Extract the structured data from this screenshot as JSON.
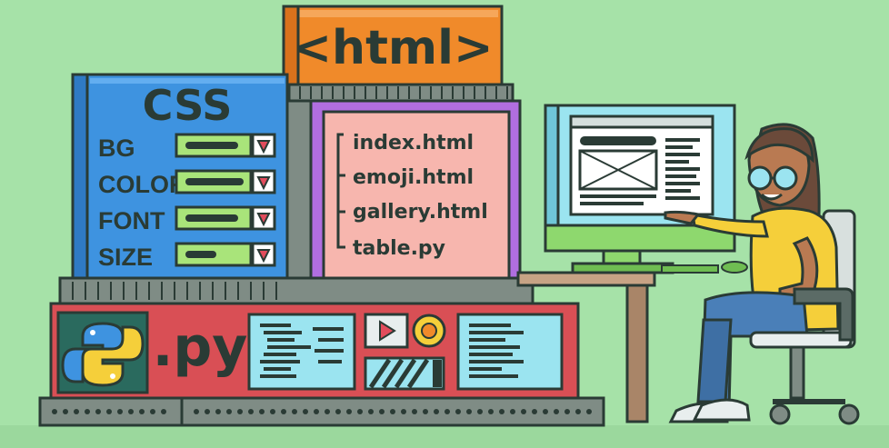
{
  "html_panel": {
    "title": "<html>"
  },
  "css_panel": {
    "title": "CSS",
    "rows": [
      {
        "label": "BG"
      },
      {
        "label": "COLOR"
      },
      {
        "label": "FONT"
      },
      {
        "label": "SIZE"
      }
    ]
  },
  "file_panel": {
    "files": [
      "index.html",
      "emoji.html",
      "gallery.html",
      "table.py"
    ]
  },
  "py_panel": {
    "title": ".py"
  },
  "colors": {
    "background": "#a6e2a8",
    "outline": "#2a3b35",
    "css_blue": "#3e93e0",
    "html_orange": "#f08a2a",
    "file_purple": "#b16ee0",
    "file_bg": "#f7b6ae",
    "py_red": "#d94f55",
    "screen_cyan": "#9be4f0",
    "monitor_green": "#8ed86e",
    "shirt_yellow": "#f5cf3a",
    "jeans_blue": "#4a7fb8"
  }
}
